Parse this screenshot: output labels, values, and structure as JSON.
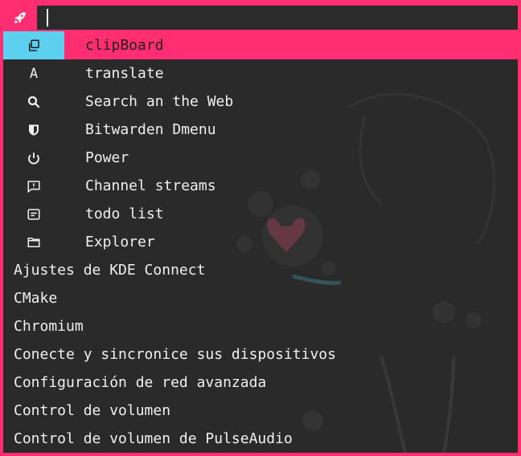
{
  "launcher": {
    "icon": "rocket-icon",
    "search": {
      "value": "",
      "placeholder": ""
    }
  },
  "colors": {
    "accent": "#ff2e73",
    "selected_icon_bg": "#5ed0ef",
    "background": "#2a2a2a",
    "text": "#f0f0f0"
  },
  "items": [
    {
      "label": "clipBoard",
      "icon": "clipboard-copy-icon",
      "glyph": "⧉",
      "selected": true
    },
    {
      "label": "translate",
      "icon": "translate-icon",
      "glyph": "A"
    },
    {
      "label": "Search an the Web",
      "icon": "search-icon",
      "glyph": ""
    },
    {
      "label": "Bitwarden Dmenu",
      "icon": "shield-icon",
      "glyph": ""
    },
    {
      "label": "Power",
      "icon": "power-icon",
      "glyph": "⏻"
    },
    {
      "label": "Channel streams",
      "icon": "chat-alert-icon",
      "glyph": ""
    },
    {
      "label": "todo list",
      "icon": "list-box-icon",
      "glyph": ""
    },
    {
      "label": "Explorer",
      "icon": "folder-icon",
      "glyph": ""
    },
    {
      "label": "Ajustes de KDE Connect"
    },
    {
      "label": "CMake"
    },
    {
      "label": "Chromium"
    },
    {
      "label": "Conecte y sincronice sus dispositivos"
    },
    {
      "label": "Configuración de red avanzada"
    },
    {
      "label": "Control de volumen"
    },
    {
      "label": "Control de volumen de PulseAudio"
    }
  ]
}
